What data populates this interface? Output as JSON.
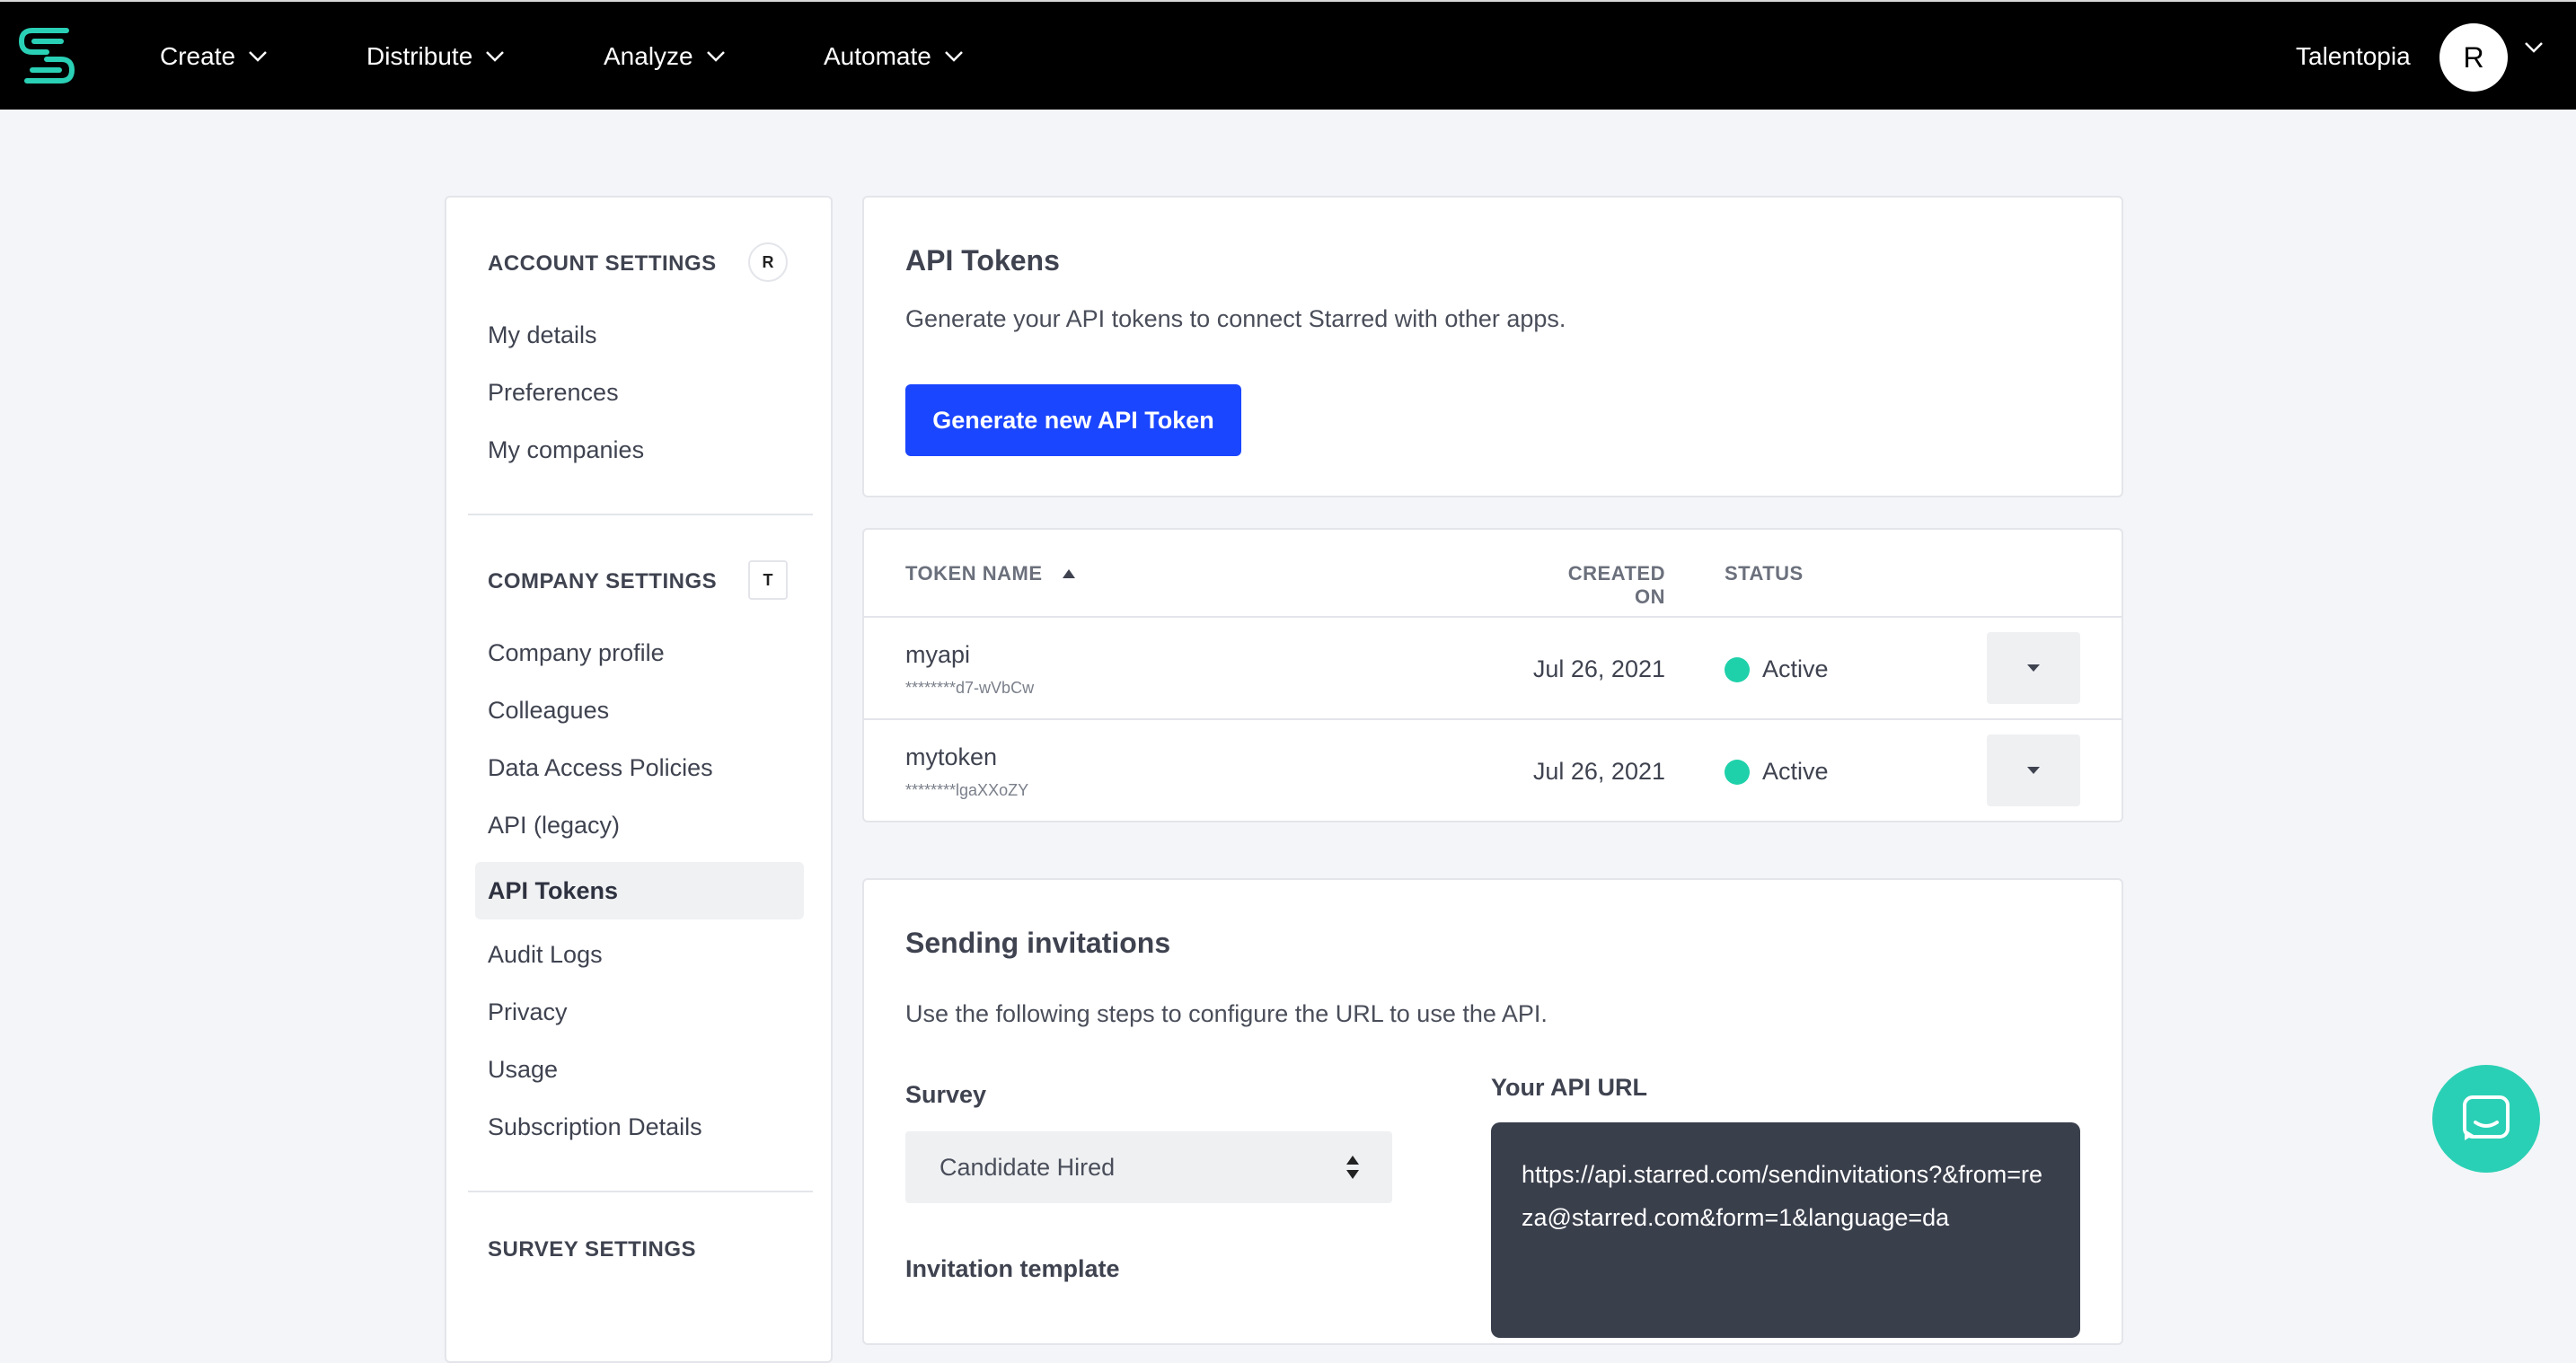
{
  "nav": {
    "items": [
      "Create",
      "Distribute",
      "Analyze",
      "Automate"
    ],
    "org_name": "Talentopia",
    "avatar_initial": "R"
  },
  "sidebar": {
    "account": {
      "heading": "ACCOUNT SETTINGS",
      "badge": "R",
      "items": [
        "My details",
        "Preferences",
        "My companies"
      ]
    },
    "company": {
      "heading": "COMPANY SETTINGS",
      "badge": "T",
      "items": [
        "Company profile",
        "Colleagues",
        "Data Access Policies",
        "API (legacy)",
        "API Tokens",
        "Audit Logs",
        "Privacy",
        "Usage",
        "Subscription Details"
      ],
      "active_item": "API Tokens"
    },
    "survey": {
      "heading": "SURVEY SETTINGS"
    }
  },
  "api_tokens_card": {
    "title": "API Tokens",
    "description": "Generate your API tokens to connect Starred with other apps.",
    "generate_button": "Generate new API Token"
  },
  "tokens_table": {
    "headers": {
      "name": "TOKEN NAME",
      "created": "CREATED ON",
      "status": "STATUS"
    },
    "rows": [
      {
        "name": "myapi",
        "masked": "********d7-wVbCw",
        "created": "Jul 26, 2021",
        "status": "Active"
      },
      {
        "name": "mytoken",
        "masked": "********lgaXXoZY",
        "created": "Jul 26, 2021",
        "status": "Active"
      }
    ]
  },
  "invitations_card": {
    "title": "Sending invitations",
    "description": "Use the following steps to configure the URL to use the API.",
    "survey_label": "Survey",
    "survey_value": "Candidate Hired",
    "template_label": "Invitation template",
    "url_label": "Your API URL",
    "url_value": "https://api.starred.com/sendinvitations?&from=reza@starred.com&form=1&language=da"
  },
  "colors": {
    "accent": "#1b46ff",
    "brand": "#2ad0b5",
    "status_active": "#1ed1aa"
  }
}
